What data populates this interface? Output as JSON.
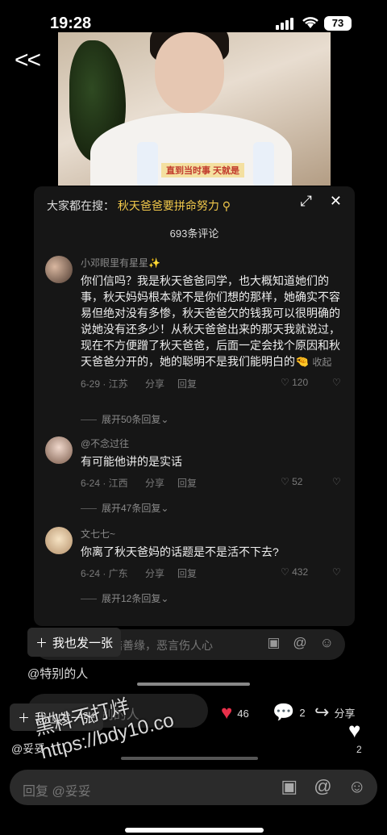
{
  "status_bar": {
    "time": "19:28",
    "battery": "73"
  },
  "video": {
    "caption": "直到当时事 天就是"
  },
  "panel": {
    "search_prefix": "大家都在搜：",
    "search_query": "秋天爸爸要拼命努力",
    "comment_count": "693条评论",
    "comments": [
      {
        "user": "小邓眼里有星星✨",
        "text": "你们信吗？我是秋天爸爸同学，也大概知道她们的事，秋天妈妈根本就不是你们想的那样，她确实不容易但绝对没有多惨，秋天爸爸欠的钱我可以很明确的说她没有还多少！从秋天爸爸出来的那天我就说过，现在不方便蹭了秋天爸爸，后面一定会找个原因和秋天爸爸分开的，她的聪明不是我们能明白的🤏",
        "fold": "收起",
        "date_loc": "6-29 · 江苏",
        "share": "分享",
        "reply": "回复",
        "likes": "120",
        "expand": "展开50条回复"
      },
      {
        "user": "@不念过往",
        "text": "有可能他讲的是实话",
        "date_loc": "6-24 · 江西",
        "share": "分享",
        "reply": "回复",
        "likes": "52",
        "expand": "展开47条回复"
      },
      {
        "user": "文七七~",
        "text": "你离了秋天爸妈的话题是不是活不下去?",
        "date_loc": "6-24 · 广东",
        "share": "分享",
        "reply": "回复",
        "likes": "432",
        "expand": "展开12条回复"
      }
    ],
    "input_placeholder": "善语结善缘，恶言伤人心"
  },
  "post_button": "我也发一张",
  "mention_1": "@特别的人",
  "bottom_input_placeholder": "回复 @特别的人",
  "actions": {
    "likes": "46",
    "comments": "2",
    "share": "分享",
    "right_likes": "2"
  },
  "mention_2": "@妥妥",
  "compose_placeholder": "回复 @妥妥",
  "watermark": {
    "line1": "黑料不打烊",
    "line2": "https://bdy10.co"
  }
}
